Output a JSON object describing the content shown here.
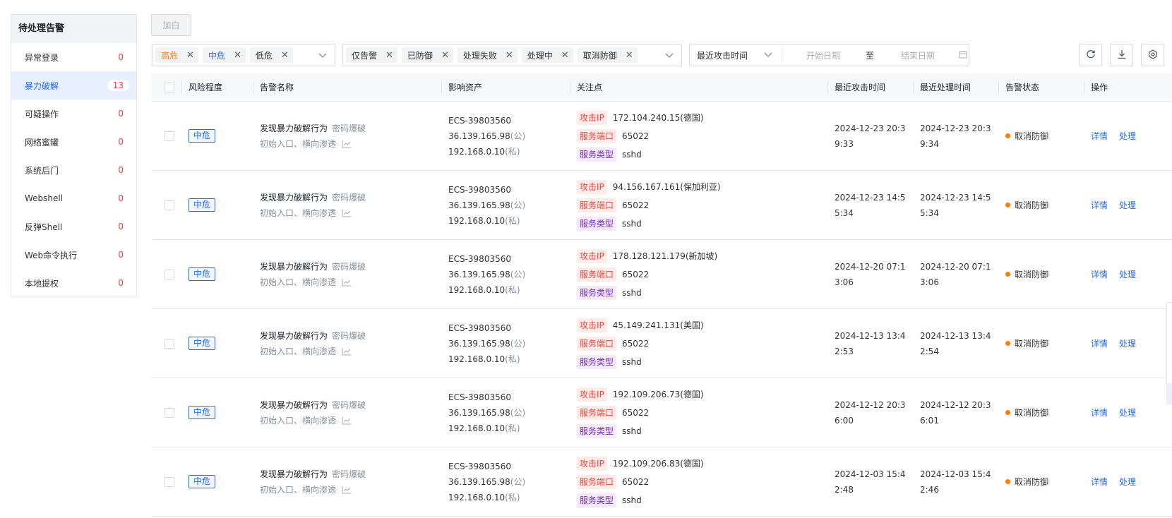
{
  "sidebar": {
    "title": "待处理告警",
    "items": [
      {
        "label": "异常登录",
        "count": "0"
      },
      {
        "label": "暴力破解",
        "count": "13"
      },
      {
        "label": "可疑操作",
        "count": "0"
      },
      {
        "label": "网络蜜罐",
        "count": "0"
      },
      {
        "label": "系统后门",
        "count": "0"
      },
      {
        "label": "Webshell",
        "count": "0"
      },
      {
        "label": "反弹Shell",
        "count": "0"
      },
      {
        "label": "Web命令执行",
        "count": "0"
      },
      {
        "label": "本地提权",
        "count": "0"
      }
    ],
    "active_index": 1
  },
  "toolbar": {
    "whitelist_label": "加白"
  },
  "filters": {
    "risk_tags": [
      "高危",
      "中危",
      "低危"
    ],
    "status_tags": [
      "仅告警",
      "已防御",
      "处理失败",
      "处理中",
      "取消防御"
    ],
    "date_type": "最近攻击时间",
    "start_placeholder": "开始日期",
    "separator": "至",
    "end_placeholder": "结束日期"
  },
  "table": {
    "headers": [
      "风险程度",
      "告警名称",
      "影响资产",
      "关注点",
      "最近攻击时间",
      "最近处理时间",
      "告警状态",
      "操作"
    ],
    "focus_labels": {
      "ip": "攻击IP",
      "port": "服务端口",
      "service": "服务类型"
    },
    "actions": [
      "详情",
      "处理"
    ],
    "rows": [
      {
        "risk": "中危",
        "name": "发现暴力破解行为",
        "type": "密码爆破",
        "sub": "初始入口、横向渗透",
        "asset_id": "ECS-39803560",
        "public_ip": "36.139.165.98",
        "public_suffix": "(公)",
        "private_ip": "192.168.0.10",
        "private_suffix": "(私)",
        "attack_ip": "172.104.240.15(德国)",
        "port": "65022",
        "service": "sshd",
        "attack_time": "2024-12-23 20:39:33",
        "handle_time": "2024-12-23 20:39:34",
        "status": "取消防御"
      },
      {
        "risk": "中危",
        "name": "发现暴力破解行为",
        "type": "密码爆破",
        "sub": "初始入口、横向渗透",
        "asset_id": "ECS-39803560",
        "public_ip": "36.139.165.98",
        "public_suffix": "(公)",
        "private_ip": "192.168.0.10",
        "private_suffix": "(私)",
        "attack_ip": "94.156.167.161(保加利亚)",
        "port": "65022",
        "service": "sshd",
        "attack_time": "2024-12-23 14:55:34",
        "handle_time": "2024-12-23 14:55:34",
        "status": "取消防御"
      },
      {
        "risk": "中危",
        "name": "发现暴力破解行为",
        "type": "密码爆破",
        "sub": "初始入口、横向渗透",
        "asset_id": "ECS-39803560",
        "public_ip": "36.139.165.98",
        "public_suffix": "(公)",
        "private_ip": "192.168.0.10",
        "private_suffix": "(私)",
        "attack_ip": "178.128.121.179(新加坡)",
        "port": "65022",
        "service": "sshd",
        "attack_time": "2024-12-20 07:13:06",
        "handle_time": "2024-12-20 07:13:06",
        "status": "取消防御"
      },
      {
        "risk": "中危",
        "name": "发现暴力破解行为",
        "type": "密码爆破",
        "sub": "初始入口、横向渗透",
        "asset_id": "ECS-39803560",
        "public_ip": "36.139.165.98",
        "public_suffix": "(公)",
        "private_ip": "192.168.0.10",
        "private_suffix": "(私)",
        "attack_ip": "45.149.241.131(美国)",
        "port": "65022",
        "service": "sshd",
        "attack_time": "2024-12-13 13:42:53",
        "handle_time": "2024-12-13 13:42:54",
        "status": "取消防御"
      },
      {
        "risk": "中危",
        "name": "发现暴力破解行为",
        "type": "密码爆破",
        "sub": "初始入口、横向渗透",
        "asset_id": "ECS-39803560",
        "public_ip": "36.139.165.98",
        "public_suffix": "(公)",
        "private_ip": "192.168.0.10",
        "private_suffix": "(私)",
        "attack_ip": "192.109.206.73(德国)",
        "port": "65022",
        "service": "sshd",
        "attack_time": "2024-12-12 20:36:00",
        "handle_time": "2024-12-12 20:36:01",
        "status": "取消防御"
      },
      {
        "risk": "中危",
        "name": "发现暴力破解行为",
        "type": "密码爆破",
        "sub": "初始入口、横向渗透",
        "asset_id": "ECS-39803560",
        "public_ip": "36.139.165.98",
        "public_suffix": "(公)",
        "private_ip": "192.168.0.10",
        "private_suffix": "(私)",
        "attack_ip": "192.109.206.83(德国)",
        "port": "65022",
        "service": "sshd",
        "attack_time": "2024-12-03 15:42:48",
        "handle_time": "2024-12-03 15:42:46",
        "status": "取消防御"
      }
    ]
  },
  "colors": {
    "primary": "#2468f2",
    "danger": "#f53f3f",
    "warning": "#ff7d00",
    "purple": "#722ed1"
  }
}
